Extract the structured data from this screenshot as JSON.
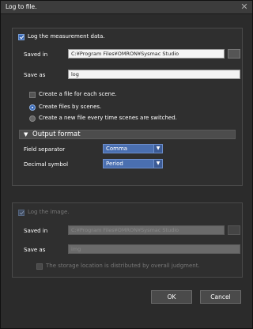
{
  "window": {
    "title": "Log to file.",
    "close_glyph": "✕"
  },
  "measurement": {
    "checkbox_label": "Log the measurement data.",
    "saved_in_label": "Saved in",
    "saved_in_value": "C:¥Program Files¥OMRON¥Sysmac Studio",
    "save_as_label": "Save as",
    "save_as_value": "log",
    "create_file_label": "Create a file for each scene.",
    "radio1_label": "Create files by scenes.",
    "radio2_label": "Create a new file every time scenes are switched."
  },
  "output_format": {
    "header": "Output format",
    "field_separator_label": "Field separator",
    "field_separator_value": "Comma",
    "decimal_symbol_label": "Decimal symbol",
    "decimal_symbol_value": "Period"
  },
  "image": {
    "checkbox_label": "Log the image.",
    "saved_in_label": "Saved in",
    "saved_in_value": "C:¥Program Files¥OMRON¥Sysmac Studio",
    "save_as_label": "Save as",
    "save_as_value": "img",
    "storage_label": "The storage location is distributed by overall judgment."
  },
  "buttons": {
    "ok": "OK",
    "cancel": "Cancel"
  },
  "icons": {
    "close": "close-icon",
    "browse": "folder-browse-icon",
    "collapse": "triangle-down-icon",
    "dropdown": "chevron-down-icon"
  }
}
